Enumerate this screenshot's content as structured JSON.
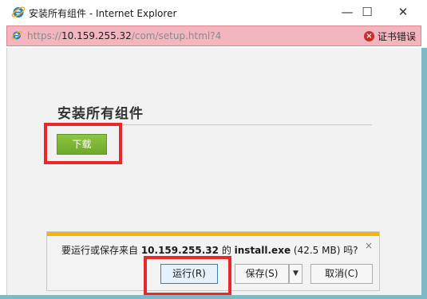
{
  "window": {
    "title": "安装所有组件 - Internet Explorer",
    "minimize_glyph": "—",
    "maximize_glyph": "☐",
    "close_glyph": "✕"
  },
  "address_bar": {
    "scheme": "https://",
    "host": "10.159.255.32",
    "path": "/com/setup.html?4",
    "cert_error_label": "证书错误",
    "cert_error_icon": "error-icon"
  },
  "page": {
    "heading": "安装所有组件",
    "download_button_label": "下载",
    "button_color": "#7bb534"
  },
  "notification": {
    "msg_prefix": "要运行或保存来自 ",
    "msg_host": "10.159.255.32",
    "msg_mid": " 的 ",
    "msg_file": "install.exe",
    "msg_size": " (42.5 MB) 吗?",
    "close_glyph": "×",
    "run_label": "运行(R)",
    "save_label": "保存(S)",
    "save_arrow": "▼",
    "cancel_label": "取消(C)",
    "accent_color": "#f4b400"
  },
  "highlight_color": "#e8282b"
}
